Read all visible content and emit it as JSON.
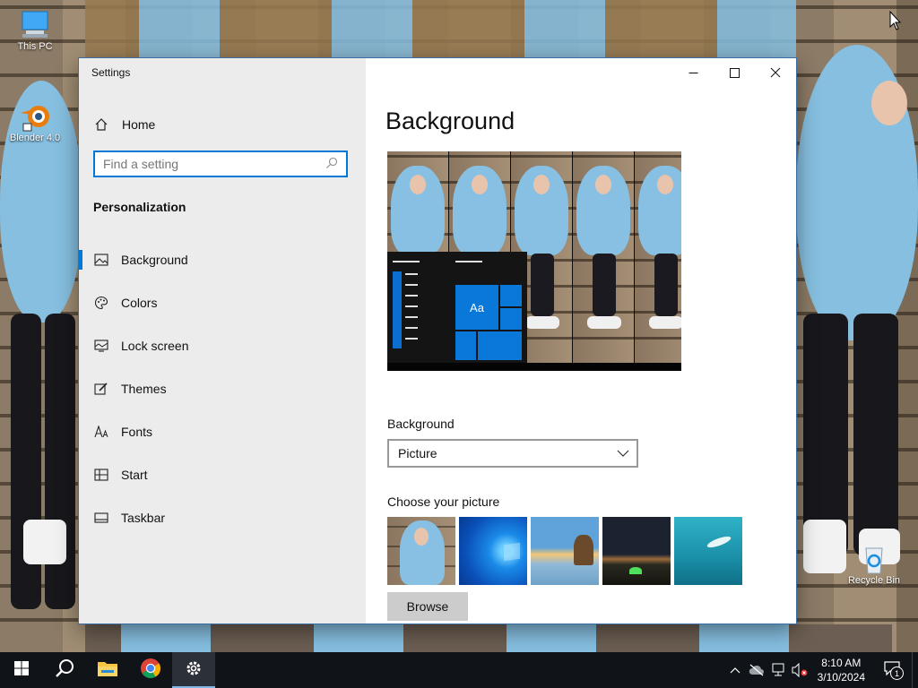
{
  "desktop": {
    "icons": [
      {
        "label": "This PC",
        "icon": "computer-icon"
      },
      {
        "label": "Blender 4.0",
        "icon": "blender-icon"
      },
      {
        "label": "Recycle Bin",
        "icon": "recycle-bin-icon"
      }
    ]
  },
  "window": {
    "title": "Settings",
    "controls": {
      "minimize": "minimize-icon",
      "maximize": "maximize-icon",
      "close": "close-icon"
    }
  },
  "sidebar": {
    "home_label": "Home",
    "search_placeholder": "Find a setting",
    "section_title": "Personalization",
    "items": [
      {
        "label": "Background",
        "icon": "background-picture-icon",
        "active": true
      },
      {
        "label": "Colors",
        "icon": "palette-icon",
        "active": false
      },
      {
        "label": "Lock screen",
        "icon": "lock-screen-icon",
        "active": false
      },
      {
        "label": "Themes",
        "icon": "themes-brush-icon",
        "active": false
      },
      {
        "label": "Fonts",
        "icon": "fonts-icon",
        "active": false
      },
      {
        "label": "Start",
        "icon": "start-layout-icon",
        "active": false
      },
      {
        "label": "Taskbar",
        "icon": "taskbar-icon",
        "active": false
      }
    ]
  },
  "content": {
    "title": "Background",
    "preview_sample_text": "Aa",
    "background_label": "Background",
    "background_value": "Picture",
    "choose_label": "Choose your picture",
    "browse_label": "Browse"
  },
  "taskbar": {
    "apps": [
      "start-icon",
      "search-icon",
      "file-explorer-icon",
      "chrome-icon",
      "settings-gear-icon"
    ],
    "time": "8:10 AM",
    "date": "3/10/2024",
    "notification_count": "1"
  },
  "colors": {
    "accent": "#0078d7",
    "sidebar_bg": "#ececec",
    "taskbar_bg": "#101318"
  }
}
